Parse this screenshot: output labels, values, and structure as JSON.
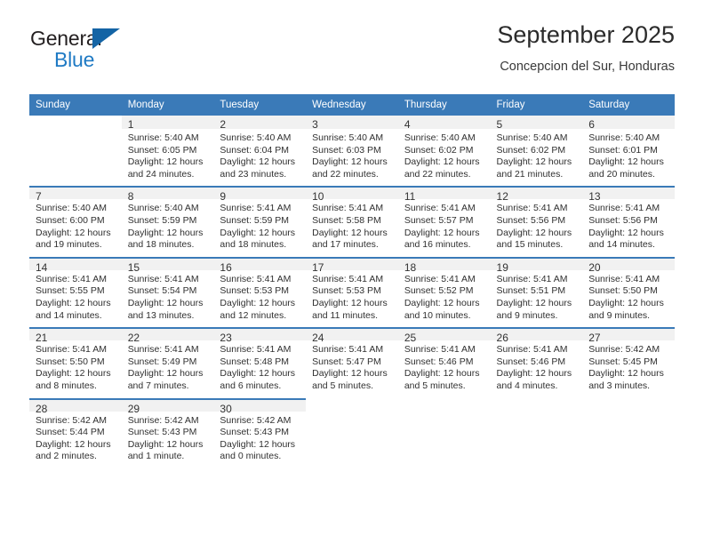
{
  "brand": {
    "word_one": "General",
    "word_two": "Blue",
    "triangle_color": "#1464a5",
    "blue_text_color": "#1f7ac4"
  },
  "header": {
    "title": "September 2025",
    "subtitle": "Concepcion del Sur, Honduras"
  },
  "theme": {
    "header_blue": "#3a7ab8",
    "daynum_band": "#f1f1f1",
    "text": "#303030"
  },
  "calendar": {
    "weekday_headers": [
      "Sunday",
      "Monday",
      "Tuesday",
      "Wednesday",
      "Thursday",
      "Friday",
      "Saturday"
    ],
    "weeks": [
      [
        {
          "day": "",
          "lines": [
            "",
            "",
            "",
            ""
          ]
        },
        {
          "day": "1",
          "lines": [
            "Sunrise: 5:40 AM",
            "Sunset: 6:05 PM",
            "Daylight: 12 hours",
            "and 24 minutes."
          ]
        },
        {
          "day": "2",
          "lines": [
            "Sunrise: 5:40 AM",
            "Sunset: 6:04 PM",
            "Daylight: 12 hours",
            "and 23 minutes."
          ]
        },
        {
          "day": "3",
          "lines": [
            "Sunrise: 5:40 AM",
            "Sunset: 6:03 PM",
            "Daylight: 12 hours",
            "and 22 minutes."
          ]
        },
        {
          "day": "4",
          "lines": [
            "Sunrise: 5:40 AM",
            "Sunset: 6:02 PM",
            "Daylight: 12 hours",
            "and 22 minutes."
          ]
        },
        {
          "day": "5",
          "lines": [
            "Sunrise: 5:40 AM",
            "Sunset: 6:02 PM",
            "Daylight: 12 hours",
            "and 21 minutes."
          ]
        },
        {
          "day": "6",
          "lines": [
            "Sunrise: 5:40 AM",
            "Sunset: 6:01 PM",
            "Daylight: 12 hours",
            "and 20 minutes."
          ]
        }
      ],
      [
        {
          "day": "7",
          "lines": [
            "Sunrise: 5:40 AM",
            "Sunset: 6:00 PM",
            "Daylight: 12 hours",
            "and 19 minutes."
          ]
        },
        {
          "day": "8",
          "lines": [
            "Sunrise: 5:40 AM",
            "Sunset: 5:59 PM",
            "Daylight: 12 hours",
            "and 18 minutes."
          ]
        },
        {
          "day": "9",
          "lines": [
            "Sunrise: 5:41 AM",
            "Sunset: 5:59 PM",
            "Daylight: 12 hours",
            "and 18 minutes."
          ]
        },
        {
          "day": "10",
          "lines": [
            "Sunrise: 5:41 AM",
            "Sunset: 5:58 PM",
            "Daylight: 12 hours",
            "and 17 minutes."
          ]
        },
        {
          "day": "11",
          "lines": [
            "Sunrise: 5:41 AM",
            "Sunset: 5:57 PM",
            "Daylight: 12 hours",
            "and 16 minutes."
          ]
        },
        {
          "day": "12",
          "lines": [
            "Sunrise: 5:41 AM",
            "Sunset: 5:56 PM",
            "Daylight: 12 hours",
            "and 15 minutes."
          ]
        },
        {
          "day": "13",
          "lines": [
            "Sunrise: 5:41 AM",
            "Sunset: 5:56 PM",
            "Daylight: 12 hours",
            "and 14 minutes."
          ]
        }
      ],
      [
        {
          "day": "14",
          "lines": [
            "Sunrise: 5:41 AM",
            "Sunset: 5:55 PM",
            "Daylight: 12 hours",
            "and 14 minutes."
          ]
        },
        {
          "day": "15",
          "lines": [
            "Sunrise: 5:41 AM",
            "Sunset: 5:54 PM",
            "Daylight: 12 hours",
            "and 13 minutes."
          ]
        },
        {
          "day": "16",
          "lines": [
            "Sunrise: 5:41 AM",
            "Sunset: 5:53 PM",
            "Daylight: 12 hours",
            "and 12 minutes."
          ]
        },
        {
          "day": "17",
          "lines": [
            "Sunrise: 5:41 AM",
            "Sunset: 5:53 PM",
            "Daylight: 12 hours",
            "and 11 minutes."
          ]
        },
        {
          "day": "18",
          "lines": [
            "Sunrise: 5:41 AM",
            "Sunset: 5:52 PM",
            "Daylight: 12 hours",
            "and 10 minutes."
          ]
        },
        {
          "day": "19",
          "lines": [
            "Sunrise: 5:41 AM",
            "Sunset: 5:51 PM",
            "Daylight: 12 hours",
            "and 9 minutes."
          ]
        },
        {
          "day": "20",
          "lines": [
            "Sunrise: 5:41 AM",
            "Sunset: 5:50 PM",
            "Daylight: 12 hours",
            "and 9 minutes."
          ]
        }
      ],
      [
        {
          "day": "21",
          "lines": [
            "Sunrise: 5:41 AM",
            "Sunset: 5:50 PM",
            "Daylight: 12 hours",
            "and 8 minutes."
          ]
        },
        {
          "day": "22",
          "lines": [
            "Sunrise: 5:41 AM",
            "Sunset: 5:49 PM",
            "Daylight: 12 hours",
            "and 7 minutes."
          ]
        },
        {
          "day": "23",
          "lines": [
            "Sunrise: 5:41 AM",
            "Sunset: 5:48 PM",
            "Daylight: 12 hours",
            "and 6 minutes."
          ]
        },
        {
          "day": "24",
          "lines": [
            "Sunrise: 5:41 AM",
            "Sunset: 5:47 PM",
            "Daylight: 12 hours",
            "and 5 minutes."
          ]
        },
        {
          "day": "25",
          "lines": [
            "Sunrise: 5:41 AM",
            "Sunset: 5:46 PM",
            "Daylight: 12 hours",
            "and 5 minutes."
          ]
        },
        {
          "day": "26",
          "lines": [
            "Sunrise: 5:41 AM",
            "Sunset: 5:46 PM",
            "Daylight: 12 hours",
            "and 4 minutes."
          ]
        },
        {
          "day": "27",
          "lines": [
            "Sunrise: 5:42 AM",
            "Sunset: 5:45 PM",
            "Daylight: 12 hours",
            "and 3 minutes."
          ]
        }
      ],
      [
        {
          "day": "28",
          "lines": [
            "Sunrise: 5:42 AM",
            "Sunset: 5:44 PM",
            "Daylight: 12 hours",
            "and 2 minutes."
          ]
        },
        {
          "day": "29",
          "lines": [
            "Sunrise: 5:42 AM",
            "Sunset: 5:43 PM",
            "Daylight: 12 hours",
            "and 1 minute."
          ]
        },
        {
          "day": "30",
          "lines": [
            "Sunrise: 5:42 AM",
            "Sunset: 5:43 PM",
            "Daylight: 12 hours",
            "and 0 minutes."
          ]
        },
        {
          "day": "",
          "lines": [
            "",
            "",
            "",
            ""
          ]
        },
        {
          "day": "",
          "lines": [
            "",
            "",
            "",
            ""
          ]
        },
        {
          "day": "",
          "lines": [
            "",
            "",
            "",
            ""
          ]
        },
        {
          "day": "",
          "lines": [
            "",
            "",
            "",
            ""
          ]
        }
      ]
    ]
  }
}
